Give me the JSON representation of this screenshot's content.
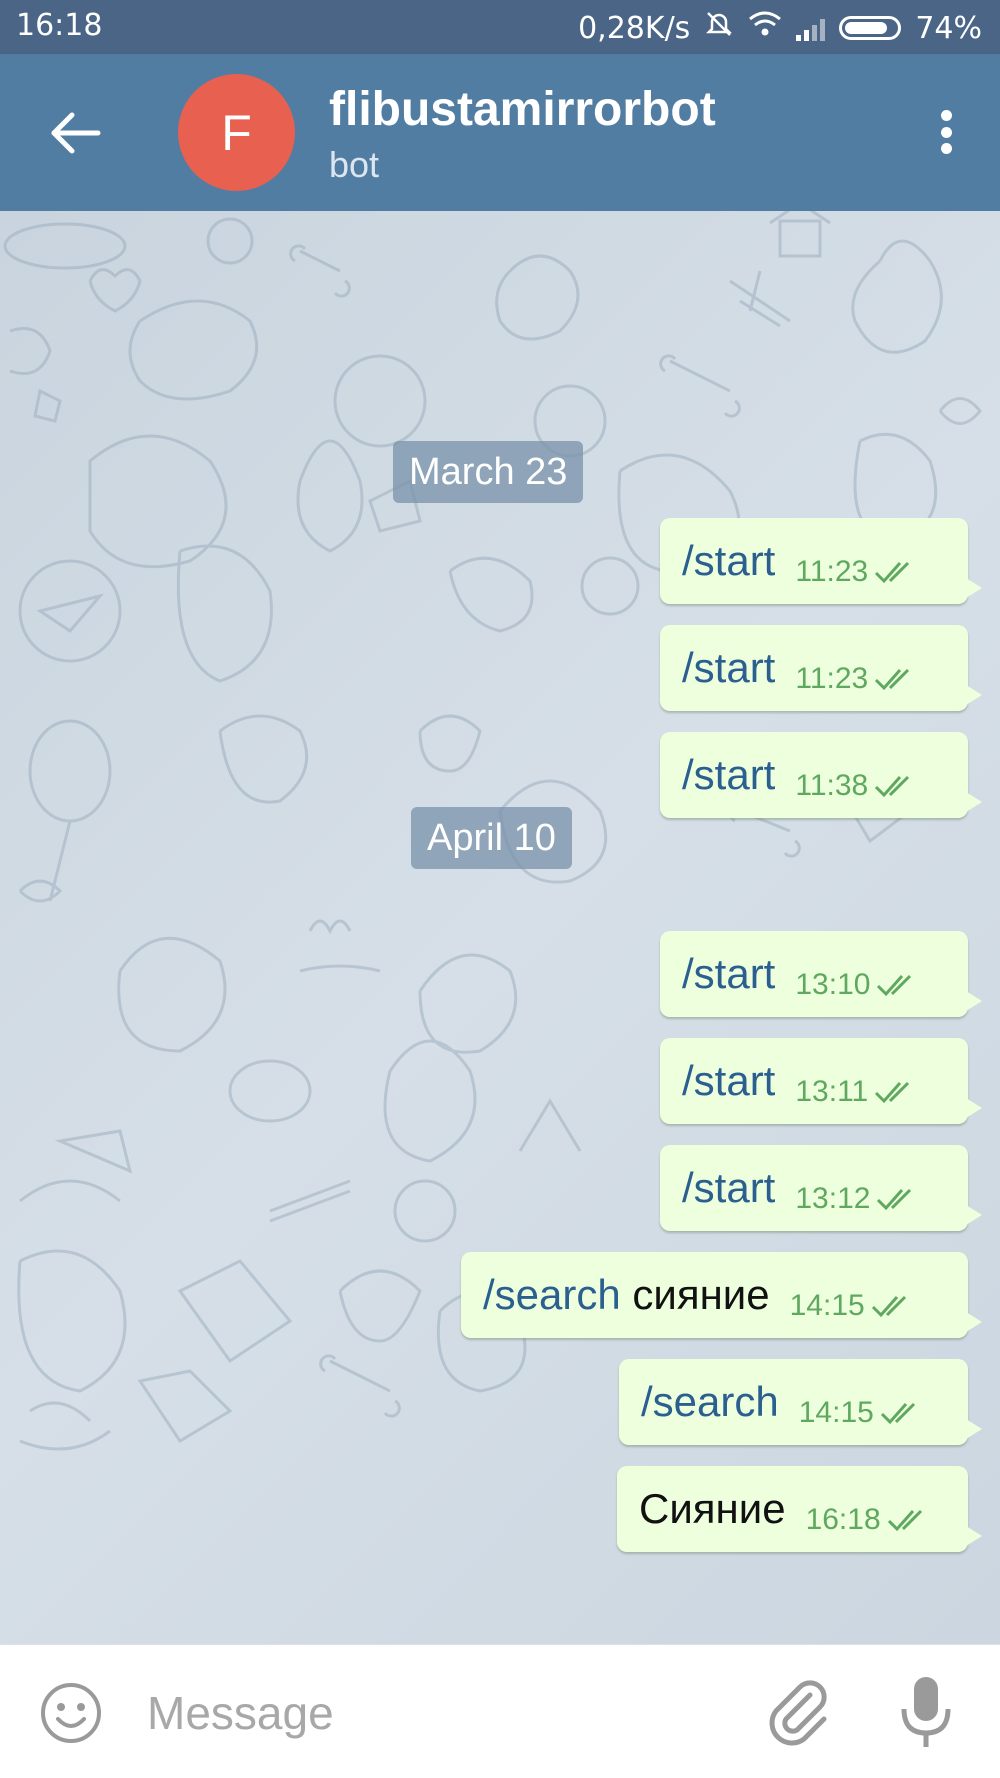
{
  "status_bar": {
    "time": "16:18",
    "net_speed": "0,28K/s",
    "battery": "74%",
    "icons": [
      "mute-icon",
      "wifi-icon",
      "signal-icon",
      "battery-icon"
    ]
  },
  "toolbar": {
    "avatar_letter": "F",
    "title": "flibustamirrorbot",
    "subtitle": "bot",
    "colors": {
      "bar": "#527da3",
      "avatar": "#e8604f"
    }
  },
  "chat": {
    "dates": [
      "March 23",
      "April 10"
    ],
    "messages": [
      {
        "command": "/start",
        "text": "",
        "time": "11:23"
      },
      {
        "command": "/start",
        "text": "",
        "time": "11:23"
      },
      {
        "command": "/start",
        "text": "",
        "time": "11:38"
      },
      {
        "command": "/start",
        "text": "",
        "time": "13:10"
      },
      {
        "command": "/start",
        "text": "",
        "time": "13:11"
      },
      {
        "command": "/start",
        "text": "",
        "time": "13:12"
      },
      {
        "command": "/search",
        "text": "сияние",
        "time": "14:15"
      },
      {
        "command": "/search",
        "text": "",
        "time": "14:15"
      },
      {
        "command": "",
        "text": "Сияние",
        "time": "16:18"
      }
    ],
    "colors": {
      "bubble": "#eeffde",
      "time": "#5fa85f",
      "command": "#2a5f8f"
    }
  },
  "input": {
    "placeholder": "Message"
  }
}
